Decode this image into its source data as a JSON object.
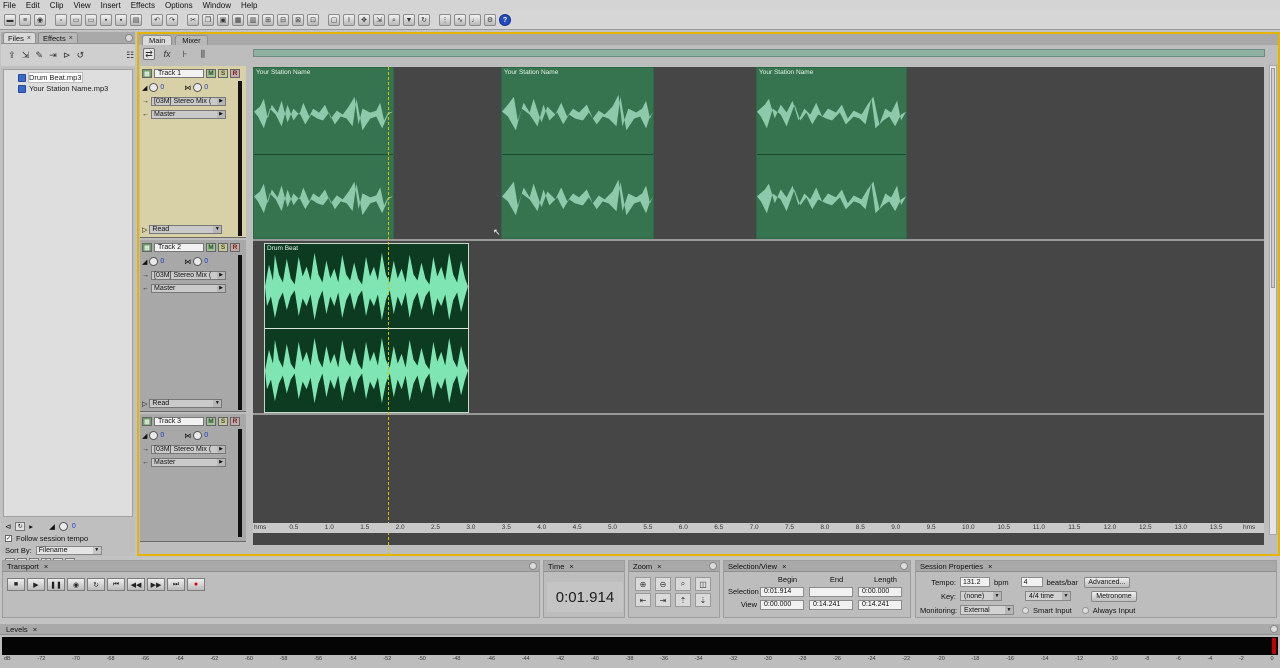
{
  "menu": [
    "File",
    "Edit",
    "Clip",
    "View",
    "Insert",
    "Effects",
    "Options",
    "Window",
    "Help"
  ],
  "toolbar_icons": [
    "waveform-view-icon",
    "multitrack-view-icon",
    "cd-view-icon",
    "new-session-icon",
    "open-icon",
    "open-file-icon",
    "save-icon",
    "save-as-icon",
    "print-icon",
    "undo-icon",
    "redo-icon",
    "cut-icon",
    "copy-icon",
    "paste-icon",
    "mix-paste-icon",
    "insert-silence-icon",
    "group-icon",
    "split-icon",
    "align-icon",
    "trim-icon",
    "lock-icon",
    "time-select-icon",
    "move-icon",
    "hybrid-icon",
    "zoom-icon",
    "marker-icon",
    "loop-icon",
    "snap-icon",
    "envelope-icon",
    "metronome-icon",
    "settings-icon",
    "help-icon"
  ],
  "files_panel": {
    "tabs": [
      {
        "label": "Files",
        "close": "×"
      },
      {
        "label": "Effects",
        "close": "×"
      }
    ],
    "files": [
      "Drum Beat.mp3",
      "Your Station Name.mp3"
    ],
    "tempo_value": "0",
    "follow_session_tempo": "Follow session tempo",
    "sort_by_label": "Sort By:",
    "sort_by_value": "Filename"
  },
  "main_panel": {
    "tabs": [
      "Main",
      "Mixer"
    ],
    "tracks": [
      {
        "name": "Track 1",
        "mute": "M",
        "solo": "S",
        "rec": "R",
        "vol": "0",
        "pan": "0",
        "input": "[03M] Stereo Mix (",
        "output": "Master",
        "automation": "Read"
      },
      {
        "name": "Track 2",
        "mute": "M",
        "solo": "S",
        "rec": "R",
        "vol": "0",
        "pan": "0",
        "input": "[03M] Stereo Mix (",
        "output": "Master",
        "automation": "Read"
      },
      {
        "name": "Track 3",
        "mute": "M",
        "solo": "S",
        "rec": "R",
        "vol": "0",
        "pan": "0",
        "input": "[03M] Stereo Mix (",
        "output": "Master"
      }
    ],
    "clips": {
      "station_label": "Your Station Name",
      "drum_label": "Drum Beat"
    },
    "ruler": [
      "hms",
      "0.5",
      "1.0",
      "1.5",
      "2.0",
      "2.5",
      "3.0",
      "3.5",
      "4.0",
      "4.5",
      "5.0",
      "5.5",
      "6.0",
      "6.5",
      "7.0",
      "7.5",
      "8.0",
      "8.5",
      "9.0",
      "9.5",
      "10.0",
      "10.5",
      "11.0",
      "11.5",
      "12.0",
      "12.5",
      "13.0",
      "13.5",
      "hms"
    ]
  },
  "transport": {
    "title": "Transport",
    "close": "×"
  },
  "time": {
    "title": "Time",
    "close": "×",
    "value": "0:01.914"
  },
  "zoom": {
    "title": "Zoom",
    "close": "×"
  },
  "selection_view": {
    "title": "Selection/View",
    "close": "×",
    "headers": [
      "Begin",
      "End",
      "Length"
    ],
    "selection_label": "Selection",
    "selection": [
      "0:01.914",
      "",
      "0:00.000"
    ],
    "view_label": "View",
    "view": [
      "0:00.000",
      "0:14.241",
      "0:14.241"
    ]
  },
  "session_properties": {
    "title": "Session Properties",
    "close": "×",
    "tempo_label": "Tempo:",
    "tempo": "131.2",
    "bpm": "bpm",
    "beats": "4",
    "beats_per_bar": "beats/bar",
    "advanced": "Advanced...",
    "key_label": "Key:",
    "key": "(none)",
    "time_sig": "4/4 time",
    "metronome": "Metronome",
    "monitoring_label": "Monitoring:",
    "monitoring": "External",
    "smart_input": "Smart Input",
    "always_input": "Always Input"
  },
  "levels": {
    "title": "Levels",
    "close": "×",
    "scale": [
      "dB",
      "-72",
      "-70",
      "-68",
      "-66",
      "-64",
      "-62",
      "-60",
      "-58",
      "-56",
      "-54",
      "-52",
      "-50",
      "-48",
      "-46",
      "-44",
      "-42",
      "-40",
      "-38",
      "-36",
      "-34",
      "-32",
      "-30",
      "-28",
      "-26",
      "-24",
      "-22",
      "-20",
      "-18",
      "-16",
      "-14",
      "-12",
      "-10",
      "-8",
      "-6",
      "-4",
      "-2",
      "0"
    ]
  }
}
